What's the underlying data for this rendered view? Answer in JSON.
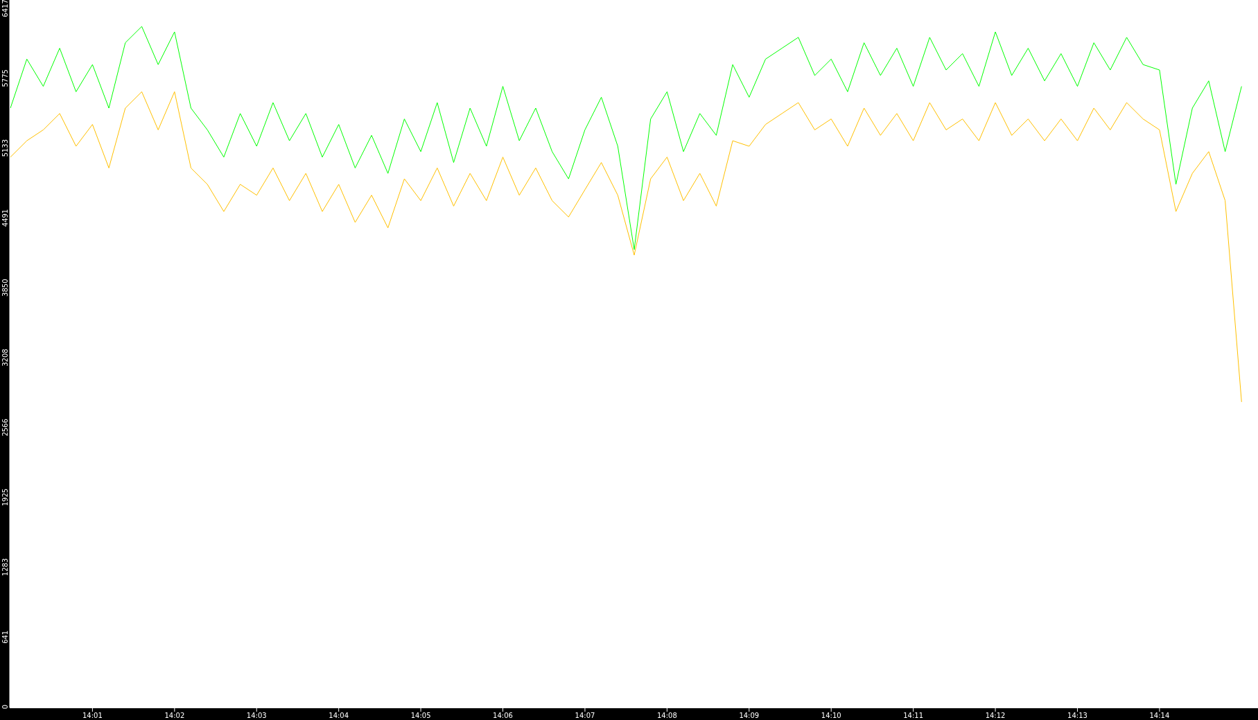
{
  "chart": {
    "chart_data": {
      "type": "line",
      "categories": [
        null,
        null,
        null,
        null,
        null,
        "14:01",
        null,
        null,
        null,
        null,
        "14:02",
        null,
        null,
        null,
        null,
        "14:03",
        null,
        null,
        null,
        null,
        "14:04",
        null,
        null,
        null,
        null,
        "14:05",
        null,
        null,
        null,
        null,
        "14:06",
        null,
        null,
        null,
        null,
        "14:07",
        null,
        null,
        null,
        null,
        "14:08",
        null,
        null,
        null,
        null,
        "14:09",
        null,
        null,
        null,
        null,
        "14:10",
        null,
        null,
        null,
        null,
        "14:11",
        null,
        null,
        null,
        null,
        "14:12",
        null,
        null,
        null,
        null,
        "14:13",
        null,
        null,
        null,
        null,
        "14:14",
        null,
        null,
        null,
        null,
        null
      ],
      "series": [
        {
          "color": "#00ff00",
          "values": [
            5500,
            5950,
            5700,
            6050,
            5650,
            5900,
            5500,
            6100,
            6250,
            5900,
            6200,
            5500,
            5300,
            5050,
            5450,
            5150,
            5550,
            5200,
            5450,
            5050,
            5350,
            4950,
            5250,
            4900,
            5400,
            5100,
            5550,
            5000,
            5500,
            5150,
            5700,
            5200,
            5500,
            5100,
            4850,
            5300,
            5600,
            5150,
            4200,
            5400,
            5650,
            5100,
            5450,
            5250,
            5900,
            5600,
            5950,
            6050,
            6150,
            5800,
            5950,
            5650,
            6100,
            5800,
            6050,
            5700,
            6150,
            5850,
            6000,
            5700,
            6200,
            5800,
            6050,
            5750,
            6000,
            5700,
            6100,
            5850,
            6150,
            5900,
            5850,
            4800,
            5500,
            5750,
            5100,
            5700
          ]
        },
        {
          "color": "#ffc000",
          "values": [
            5050,
            5200,
            5300,
            5450,
            5150,
            5350,
            4950,
            5500,
            5650,
            5300,
            5650,
            4950,
            4800,
            4550,
            4800,
            4700,
            4950,
            4650,
            4900,
            4550,
            4800,
            4450,
            4700,
            4400,
            4850,
            4650,
            4950,
            4600,
            4900,
            4650,
            5050,
            4700,
            4950,
            4650,
            4500,
            4750,
            5000,
            4700,
            4150,
            4850,
            5050,
            4650,
            4900,
            4600,
            5200,
            5150,
            5350,
            5450,
            5550,
            5300,
            5400,
            5150,
            5500,
            5250,
            5450,
            5200,
            5550,
            5300,
            5400,
            5200,
            5550,
            5250,
            5400,
            5200,
            5400,
            5200,
            5500,
            5300,
            5550,
            5400,
            5300,
            4550,
            4900,
            5100,
            4650,
            2800
          ]
        }
      ],
      "ylim": [
        0,
        6493
      ],
      "yticks": [
        0,
        641,
        1283,
        1925,
        2566,
        3208,
        3850,
        4491,
        5133,
        5775,
        6417
      ]
    }
  }
}
